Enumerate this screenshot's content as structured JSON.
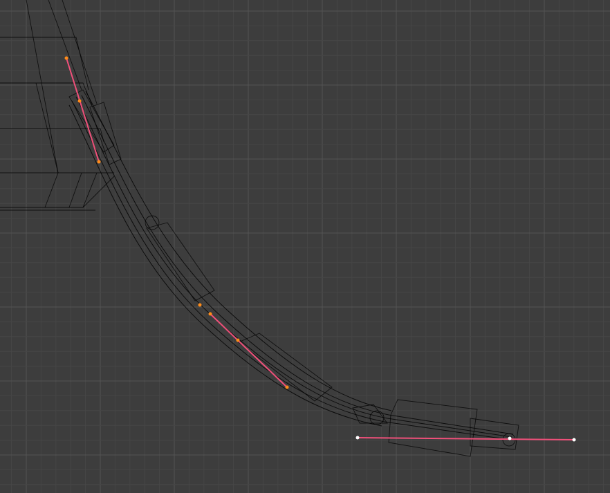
{
  "viewport": {
    "editor": "3D Viewport",
    "shading": "wireframe",
    "background_color": "#3d3d3d",
    "grid_minor_color": "#464646",
    "grid_major_color": "#545454",
    "wire_color": "#000000",
    "handle_color_selected": "#f0507a",
    "point_color_selected": "#ff8c1a",
    "point_color_unselected": "#ffffff"
  },
  "curve": {
    "type": "bezier",
    "control_points": [
      {
        "state": "selected"
      },
      {
        "state": "selected"
      },
      {
        "state": "unselected"
      }
    ]
  },
  "armature": {
    "bones_visible": 6
  }
}
